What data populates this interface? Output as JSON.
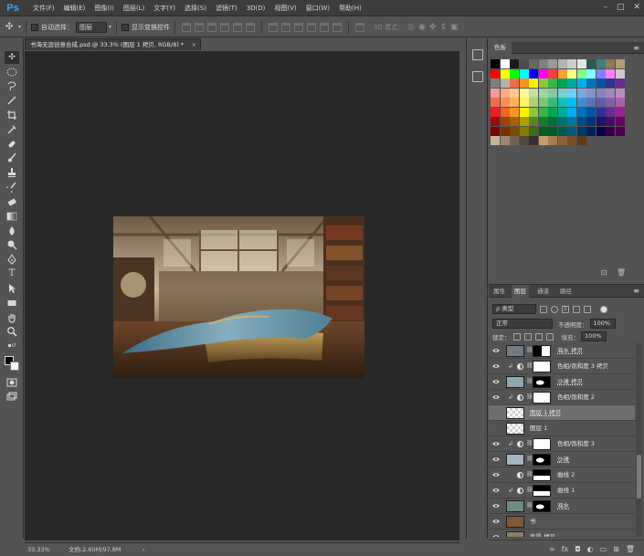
{
  "app": {
    "logo": "Ps"
  },
  "menu": [
    "文件(F)",
    "编辑(E)",
    "图像(I)",
    "图层(L)",
    "文字(Y)",
    "选择(S)",
    "滤镜(T)",
    "3D(D)",
    "视图(V)",
    "窗口(W)",
    "帮助(H)"
  ],
  "window_controls": {
    "minimize": "–",
    "restore": "□",
    "close": "✕"
  },
  "options": {
    "auto_select_label": "自动选择：",
    "auto_select_value": "图层",
    "show_transform_label": "显示变换控件",
    "mode_3d_label": "3D 模式："
  },
  "document": {
    "tab_title": "书海无涯创意合成.psd @ 33.3% (图层 1 拷贝, RGB/8) *",
    "close": "×"
  },
  "status": {
    "zoom": "33.33%",
    "doc_size": "文档:2.60M/97.8M",
    "arrow": "›"
  },
  "swatches": {
    "tab": "色板",
    "menu": "≡",
    "footer_new": "⊡",
    "footer_delete": "🗑",
    "colors": [
      [
        "#000000",
        "#ffffff",
        "#1a1a1a",
        "#4d4d4d",
        "#666666",
        "#808080",
        "#999999",
        "#b3b3b3",
        "#cccccc",
        "#e6e6e6",
        "#2a5a5a",
        "#3f7c7c",
        "#8c7a5c",
        "#b59c72"
      ],
      [
        "#ff0000",
        "#ffff00",
        "#00ff00",
        "#00ffff",
        "#0000ff",
        "#ff00ff",
        "#ff3f3f",
        "#ff9f3f",
        "#ffff7f",
        "#7fff7f",
        "#7fffff",
        "#7f7fff",
        "#ff7fff",
        "#cccccc"
      ],
      [
        "#808080",
        "#b3b3b3",
        "#f26c4f",
        "#f7941d",
        "#fff200",
        "#8dc63f",
        "#39b54a",
        "#00a651",
        "#00a99d",
        "#00aeef",
        "#0072bc",
        "#0054a6",
        "#2e3192",
        "#662d91"
      ],
      [
        "#f6989d",
        "#f9ad81",
        "#fdc68a",
        "#fff79a",
        "#c4df9b",
        "#a3d39c",
        "#82ca9d",
        "#7bcdc8",
        "#6ecff6",
        "#7ea7d8",
        "#8493ca",
        "#8882be",
        "#a187be",
        "#bc8dbf"
      ],
      [
        "#f26c4f",
        "#f68e55",
        "#fbaf5d",
        "#fff467",
        "#acd372",
        "#7cc576",
        "#3bb878",
        "#1abbb4",
        "#00bff3",
        "#438ccb",
        "#5574b9",
        "#605ca8",
        "#855fa8",
        "#a763a8"
      ],
      [
        "#ed1c24",
        "#f26522",
        "#f7941d",
        "#fff200",
        "#8dc73f",
        "#39b54a",
        "#00a651",
        "#00a99d",
        "#00aeef",
        "#0072bc",
        "#0054a6",
        "#2e3192",
        "#662d91",
        "#92278f"
      ],
      [
        "#9e0b0f",
        "#a0410d",
        "#a36209",
        "#aba000",
        "#598527",
        "#1a7b30",
        "#007236",
        "#00746b",
        "#0076a3",
        "#004b80",
        "#003471",
        "#1b1464",
        "#440e62",
        "#630460"
      ],
      [
        "#790000",
        "#7b2e00",
        "#7d4900",
        "#827b00",
        "#406618",
        "#005e20",
        "#005826",
        "#005952",
        "#005b7f",
        "#003663",
        "#002157",
        "#0d004c",
        "#32004b",
        "#4b0049"
      ],
      [
        "#c7b299",
        "#998675",
        "#736357",
        "#534741",
        "#37302d",
        "#c69c6d",
        "#a67c52",
        "#8c6239",
        "#754c24",
        "#603913"
      ]
    ]
  },
  "layers": {
    "tabs": [
      "属性",
      "图层",
      "通道",
      "路径"
    ],
    "active_tab": "图层",
    "menu": "≡",
    "filter_kind": "ρ 类型",
    "blend_mode": "正常",
    "opacity_label": "不透明度：",
    "opacity_value": "100%",
    "lock_label": "锁定：",
    "fill_label": "填充：",
    "fill_value": "100%",
    "items": [
      {
        "name": "海水 拷贝",
        "kind": "pixel-mask",
        "thumb": "#6d7d83",
        "mask": "black-white",
        "visible": true,
        "clipped": false,
        "selected": false,
        "underline": true
      },
      {
        "name": "色相/饱和度 3 拷贝",
        "kind": "adjust",
        "visible": true,
        "clipped": true,
        "selected": false,
        "underline": false
      },
      {
        "name": "沙滩 拷贝",
        "kind": "pixel-mask",
        "thumb": "#8fa6b2",
        "mask": "black-shape",
        "visible": true,
        "clipped": false,
        "selected": false,
        "underline": true
      },
      {
        "name": "色相/饱和度 2",
        "kind": "adjust",
        "visible": true,
        "clipped": true,
        "selected": false,
        "underline": false
      },
      {
        "name": "图层 1 拷贝",
        "kind": "pixel",
        "visible": false,
        "clipped": false,
        "selected": true,
        "underline": true
      },
      {
        "name": "图层 1",
        "kind": "pixel",
        "visible": false,
        "clipped": false,
        "selected": false,
        "underline": false
      },
      {
        "name": "色相/饱和度 3",
        "kind": "adjust",
        "visible": true,
        "clipped": true,
        "selected": false,
        "underline": false
      },
      {
        "name": "沙滩",
        "kind": "pixel-mask",
        "thumb": "#a3b5c0",
        "mask": "black-shape",
        "visible": true,
        "clipped": false,
        "selected": false,
        "underline": true
      },
      {
        "name": "曲线 2",
        "kind": "curve",
        "visible": true,
        "clipped": false,
        "selected": false,
        "underline": false
      },
      {
        "name": "曲线 1",
        "kind": "curve",
        "visible": true,
        "clipped": true,
        "selected": false,
        "underline": false
      },
      {
        "name": "海水",
        "kind": "pixel-mask",
        "thumb": "#6f8b86",
        "mask": "black-shape",
        "visible": true,
        "clipped": false,
        "selected": false,
        "underline": true
      },
      {
        "name": "书",
        "kind": "pixel",
        "thumb": "#7d5a3a",
        "visible": true,
        "clipped": false,
        "selected": false,
        "underline": false
      },
      {
        "name": "背景 拷贝",
        "kind": "pixel",
        "thumb": "#8d7e66",
        "visible": true,
        "clipped": false,
        "selected": false,
        "underline": false
      }
    ],
    "footer": [
      "∞",
      "fx",
      "◘",
      "◐",
      "▭",
      "⊞",
      "🗑"
    ]
  }
}
